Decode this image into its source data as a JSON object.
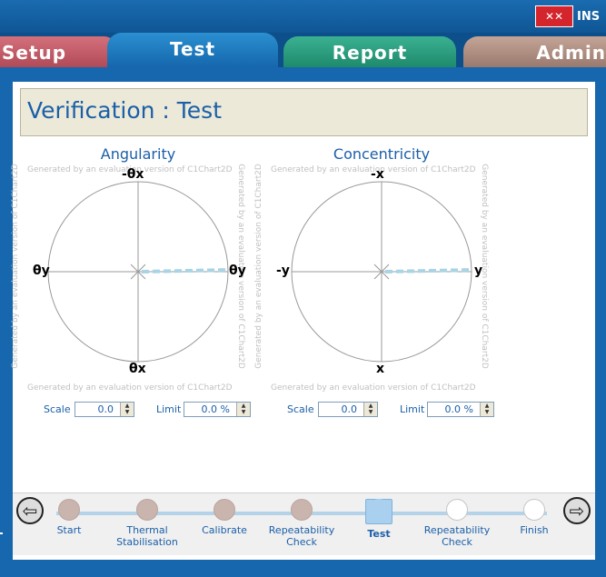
{
  "header": {
    "logo_text": "INS"
  },
  "tabs": [
    {
      "label": "Setup"
    },
    {
      "label": "Test"
    },
    {
      "label": "Report"
    },
    {
      "label": "Admin"
    }
  ],
  "page": {
    "title": "Verification :  Test"
  },
  "watermark": "Generated by an evaluation version of C1Chart2D",
  "charts": [
    {
      "title": "Angularity",
      "labels": {
        "top": "-θx",
        "bottom": "θx",
        "left": "θy",
        "right": "θy"
      },
      "scale_label": "Scale",
      "scale_value": "0.0",
      "limit_label": "Limit",
      "limit_value": "0.0 %"
    },
    {
      "title": "Concentricity",
      "labels": {
        "top": "-x",
        "bottom": "x",
        "left": "-y",
        "right": "y"
      },
      "scale_label": "Scale",
      "scale_value": "0.0",
      "limit_label": "Limit",
      "limit_value": "0.0 %"
    }
  ],
  "steps": [
    {
      "label": "Start",
      "state": "done"
    },
    {
      "label": "Thermal Stabilisation",
      "state": "done"
    },
    {
      "label": "Calibrate",
      "state": "done"
    },
    {
      "label": "Repeatability Check",
      "state": "done"
    },
    {
      "label": "Test",
      "state": "active"
    },
    {
      "label": "Repeatability Check",
      "state": "pending"
    },
    {
      "label": "Finish",
      "state": "pending"
    }
  ],
  "colors": {
    "accent": "#1b5fa8",
    "frame": "#1667ad",
    "trace": "#a9d4e6"
  }
}
